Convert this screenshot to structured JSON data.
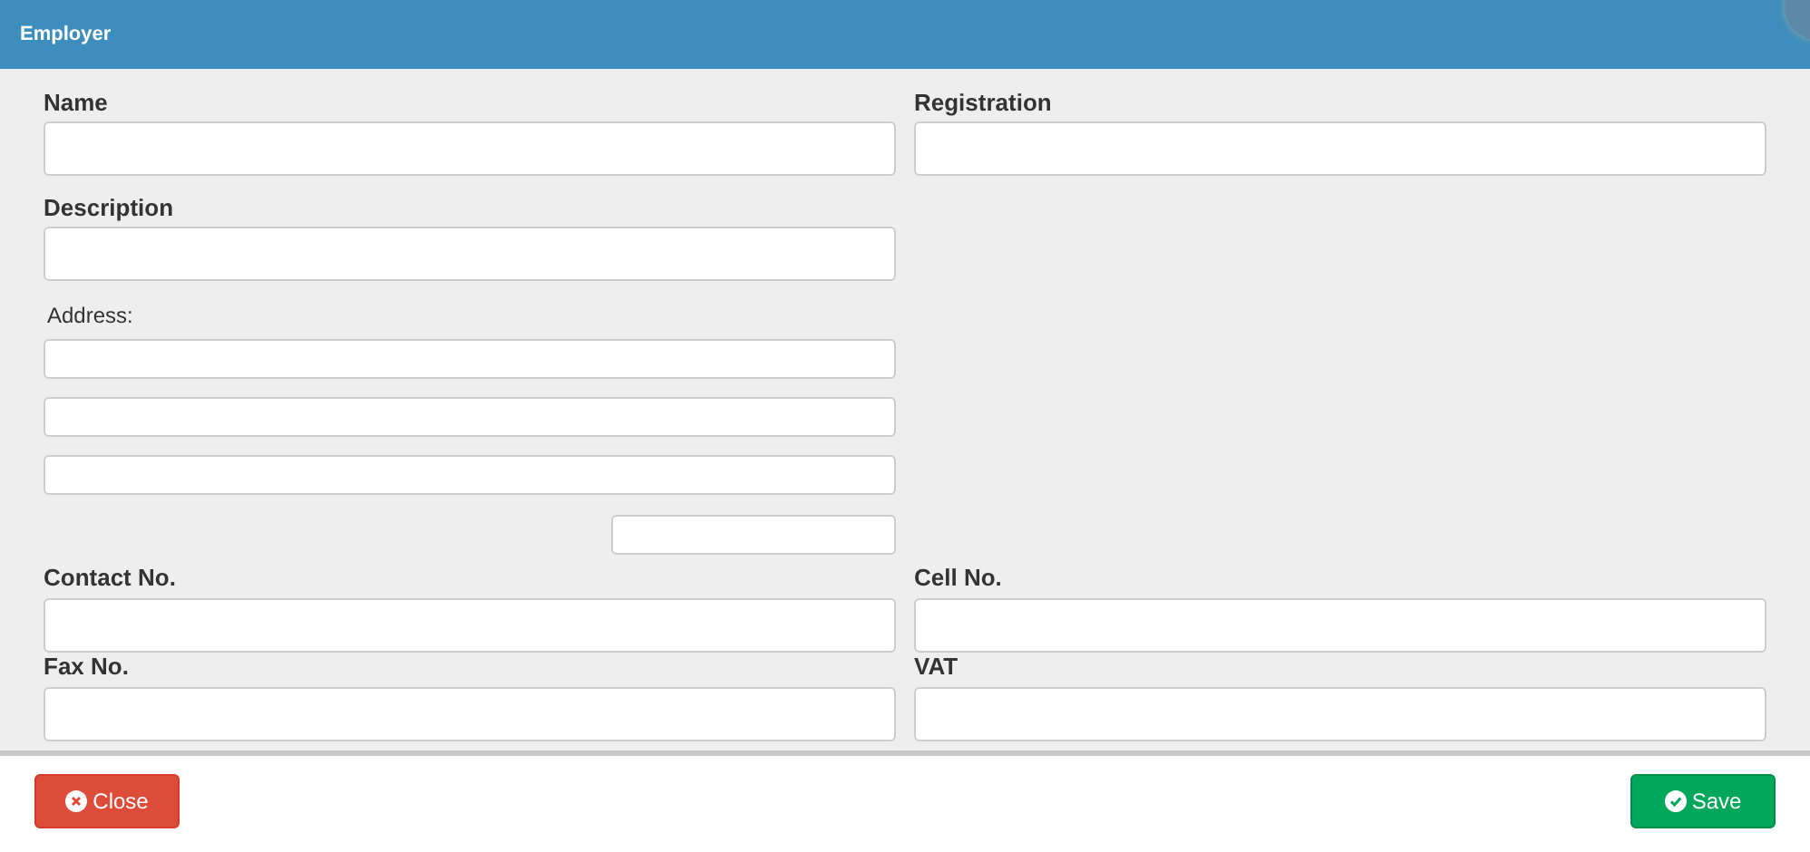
{
  "window": {
    "title": "Employer"
  },
  "sections": [
    {
      "kind": "pairs",
      "rows": [
        [
          {
            "label": "Name"
          },
          {
            "label": "Registration"
          }
        ],
        [
          {
            "label": "Description"
          }
        ]
      ]
    },
    {
      "kind": "address",
      "label": "Address:",
      "fields": [
        {
          "kind": "line"
        },
        {
          "kind": "line"
        },
        {
          "kind": "line"
        },
        {
          "kind": "postcode"
        }
      ]
    },
    {
      "kind": "pairs",
      "rows": [
        [
          {
            "label": "Contact No."
          },
          {
            "label": "Cell No."
          }
        ],
        [
          {
            "label": "Fax No."
          },
          {
            "label": "VAT"
          }
        ]
      ]
    }
  ],
  "buttons": [
    {
      "label": "Close",
      "kind": "close"
    },
    {
      "label": "Save",
      "kind": "save"
    }
  ]
}
